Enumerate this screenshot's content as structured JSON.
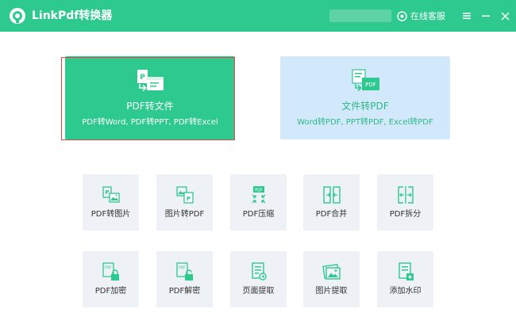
{
  "app": {
    "title": "LinkPdf转换器",
    "support": "在线客服",
    "colors": {
      "primary": "#2ec98e",
      "secondary": "#d2e8fb",
      "tile": "#eef1f5"
    }
  },
  "main_cards": [
    {
      "title": "PDF转文件",
      "subtitle": "PDF转Word, PDF转PPT, PDF转Excel",
      "icon": "pdf-to-file-icon",
      "selected": true
    },
    {
      "title": "文件转PDF",
      "subtitle": "Word转PDF, PPT转PDF, Excel转PDF",
      "icon": "file-to-pdf-icon",
      "badge": "PDF"
    }
  ],
  "tools": [
    {
      "label": "PDF转图片",
      "icon": "pdf-to-image-icon"
    },
    {
      "label": "图片转PDF",
      "icon": "image-to-pdf-icon"
    },
    {
      "label": "PDF压缩",
      "icon": "pdf-compress-icon",
      "badge": "PDF"
    },
    {
      "label": "PDF合并",
      "icon": "pdf-merge-icon"
    },
    {
      "label": "PDF拆分",
      "icon": "pdf-split-icon"
    },
    {
      "label": "PDF加密",
      "icon": "pdf-encrypt-icon",
      "badge": "PDF"
    },
    {
      "label": "PDF解密",
      "icon": "pdf-decrypt-icon",
      "badge": "PDF"
    },
    {
      "label": "页面提取",
      "icon": "page-extract-icon"
    },
    {
      "label": "图片提取",
      "icon": "image-extract-icon"
    },
    {
      "label": "添加水印",
      "icon": "add-watermark-icon"
    }
  ]
}
